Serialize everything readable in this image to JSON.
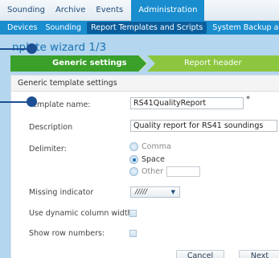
{
  "topnav": {
    "tabs": [
      "Sounding",
      "Archive",
      "Events",
      "Administration"
    ],
    "active_index": 3
  },
  "subnav": {
    "items": [
      "Devices",
      "Sounding",
      "Report Templates and Scripts",
      "System Backup and"
    ],
    "active_index": 2
  },
  "wizard": {
    "title": "nplate wizard 1/3",
    "steps": [
      "Generic settings",
      "Report header"
    ]
  },
  "panel": {
    "header": "Generic template settings",
    "template_name": {
      "label": "Template name:",
      "value": "RS41QualityReport",
      "required_mark": "*"
    },
    "description": {
      "label": "Description",
      "value": "Quality report for RS41 soundings"
    },
    "delimiter": {
      "label": "Delimiter:",
      "options": [
        "Comma",
        "Space",
        "Other"
      ],
      "selected": "Space"
    },
    "missing_indicator": {
      "label": "Missing indicator",
      "value": "/////"
    },
    "dynamic_width": {
      "label": "Use dynamic column width:"
    },
    "row_numbers": {
      "label": "Show row numbers:"
    }
  },
  "buttons": {
    "cancel": "Cancel",
    "next": "Next"
  },
  "colors": {
    "nav_active": "#1a8dcf",
    "step_active": "#3aa02a",
    "step_inactive": "#8cc63f",
    "callout": "#1c4f93"
  }
}
